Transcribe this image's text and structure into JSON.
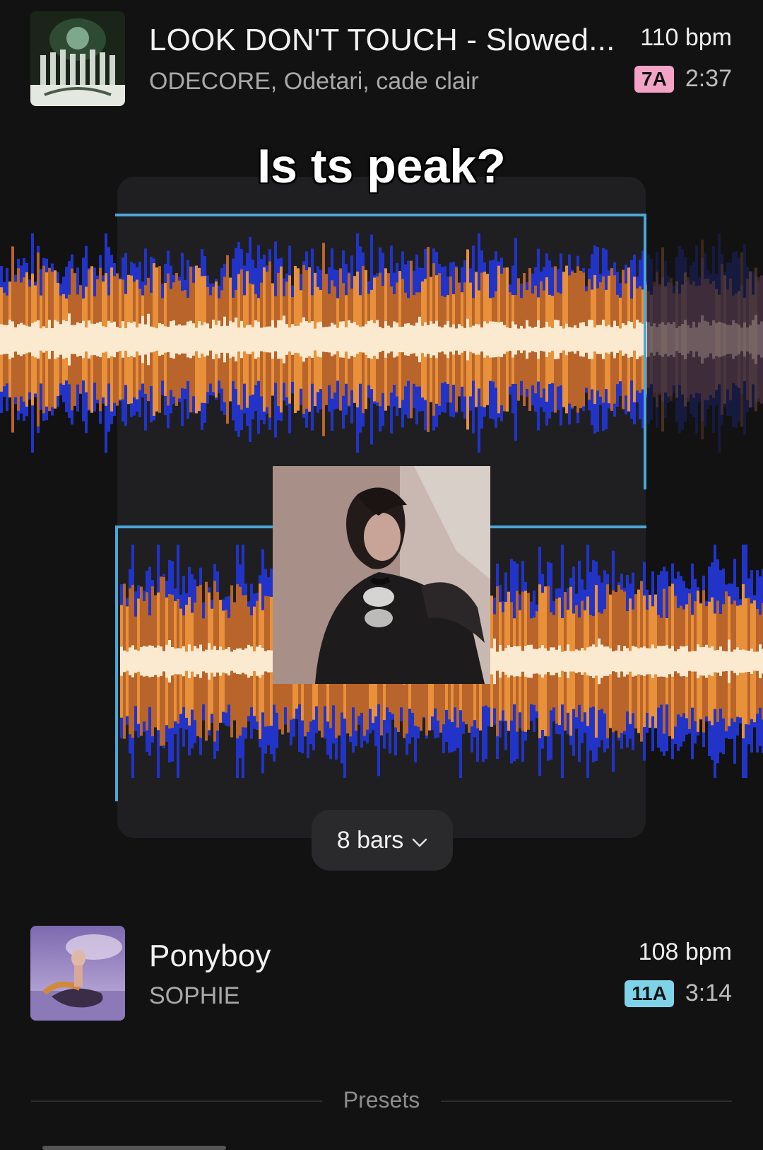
{
  "track1": {
    "title": "LOOK DON'T TOUCH - Slowed...",
    "artist": "ODECORE, Odetari, cade clair",
    "bpm": "110 bpm",
    "key": "7A",
    "key_color": "#f3a3c6",
    "duration": "2:37"
  },
  "caption": "Is ts peak?",
  "waveform_colors": {
    "low": "#fbe9d0",
    "mid": "#b8642a",
    "mid_light": "#e8903a",
    "high": "#2234c8",
    "marker": "#4ba7d6"
  },
  "bars_selector": {
    "label": "8 bars",
    "icon": "chevron-down-icon"
  },
  "track2": {
    "title": "Ponyboy",
    "artist": "SOPHIE",
    "bpm": "108 bpm",
    "key": "11A",
    "key_color": "#7fd3e8",
    "duration": "3:14"
  },
  "presets_label": "Presets"
}
